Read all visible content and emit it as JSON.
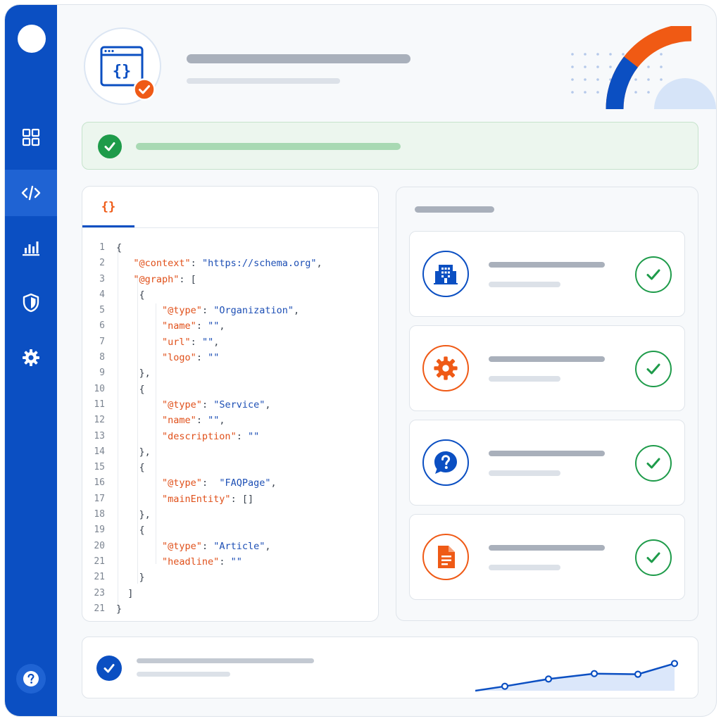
{
  "sidebar": {
    "items": [
      {
        "name": "dashboard",
        "icon": "grid-icon",
        "active": false
      },
      {
        "name": "code",
        "icon": "code-icon",
        "active": true
      },
      {
        "name": "analytics",
        "icon": "bar-chart-icon",
        "active": false
      },
      {
        "name": "security",
        "icon": "shield-icon",
        "active": false
      },
      {
        "name": "settings",
        "icon": "gear-icon",
        "active": false
      }
    ],
    "help_icon": "help-icon"
  },
  "header": {
    "badge_icon": "code-window-icon",
    "badge_status_icon": "check-badge-icon"
  },
  "banner": {
    "status": "success",
    "icon": "check-circle-icon"
  },
  "editor": {
    "tab_label": "{}",
    "lines": [
      {
        "n": "1",
        "t": "{"
      },
      {
        "n": "2",
        "t": "   \"@context\": \"https://schema.org\","
      },
      {
        "n": "3",
        "t": "   \"@graph\": ["
      },
      {
        "n": "4",
        "t": "    {"
      },
      {
        "n": "5",
        "t": "        \"@type\": \"Organization\","
      },
      {
        "n": "6",
        "t": "        \"name\": \"\","
      },
      {
        "n": "7",
        "t": "        \"url\": \"\","
      },
      {
        "n": "8",
        "t": "        \"logo\": \"\""
      },
      {
        "n": "9",
        "t": "    },"
      },
      {
        "n": "10",
        "t": "    {"
      },
      {
        "n": "11",
        "t": "        \"@type\": \"Service\","
      },
      {
        "n": "12",
        "t": "        \"name\": \"\","
      },
      {
        "n": "13",
        "t": "        \"description\": \"\""
      },
      {
        "n": "14",
        "t": "    },"
      },
      {
        "n": "15",
        "t": "    {"
      },
      {
        "n": "16",
        "t": "        \"@type\":  \"FAQPage\","
      },
      {
        "n": "17",
        "t": "        \"mainEntity\": []"
      },
      {
        "n": "18",
        "t": "    },"
      },
      {
        "n": "19",
        "t": "    {"
      },
      {
        "n": "20",
        "t": "        \"@type\": \"Article\","
      },
      {
        "n": "21",
        "t": "        \"headline\": \"\""
      },
      {
        "n": "21",
        "t": "    }"
      },
      {
        "n": "23",
        "t": "  ]"
      },
      {
        "n": "21",
        "t": "}"
      }
    ]
  },
  "checks": {
    "items": [
      {
        "icon": "building-icon",
        "color": "#0b4fc2",
        "status": "valid"
      },
      {
        "icon": "gear-icon",
        "color": "#ef5a16",
        "status": "valid"
      },
      {
        "icon": "question-bubble-icon",
        "color": "#0b4fc2",
        "status": "valid"
      },
      {
        "icon": "document-icon",
        "color": "#ef5a16",
        "status": "valid"
      }
    ]
  },
  "footer": {
    "icon": "check-circle-icon",
    "trend": [
      0,
      0.14,
      0.37,
      0.54,
      0.52,
      0.86
    ]
  },
  "colors": {
    "brand": "#0b4fc2",
    "accent": "#ef5a16",
    "success": "#1e9b4a",
    "placeholder": "#a9b0bb"
  }
}
